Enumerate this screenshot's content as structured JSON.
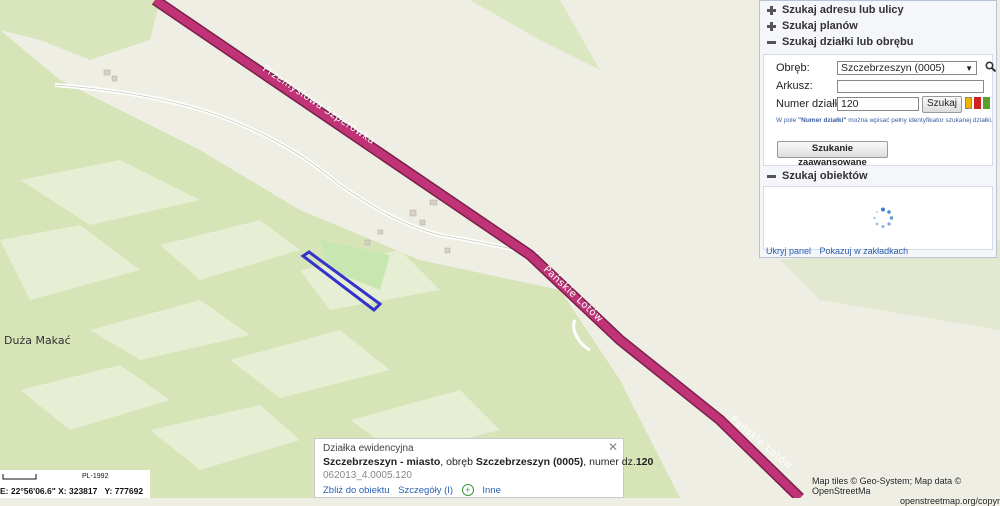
{
  "map": {
    "road_label_1": "Przemysłowa Szperówka",
    "road_label_2": "Pańskie Lotów",
    "road_label_3": "Pańskie Lotów",
    "place_label": "Duża Makać"
  },
  "panel": {
    "sections": [
      {
        "label": "Szukaj adresu lub ulicy",
        "state": "collapsed"
      },
      {
        "label": "Szukaj planów",
        "state": "collapsed"
      },
      {
        "label": "Szukaj działki lub obrębu",
        "state": "expanded"
      },
      {
        "label": "Szukaj obiektów",
        "state": "expanded"
      }
    ],
    "form": {
      "obreb_label": "Obręb:",
      "obreb_value": "Szczebrzeszyn (0005)",
      "arkusz_label": "Arkusz:",
      "arkusz_value": "",
      "numer_label": "Numer działki:",
      "numer_value": "120",
      "search_button": "Szukaj",
      "hint_prefix": "W pole ",
      "hint_field": "\"Numer działki\"",
      "hint_suffix": " można wpisać pełny identyfikator szukanej działki.",
      "advanced_button": "Szukanie zaawansowane"
    },
    "links": {
      "hide_panel": "Ukryj panel",
      "show_in_tabs": "Pokazuj w zakładkach"
    },
    "swatch_colors": [
      "#f0b400",
      "#d02020",
      "#5aa02a"
    ]
  },
  "popup": {
    "title": "Działka ewidencyjna",
    "town": "Szczebrzeszyn - miasto",
    "sep1": ", obręb ",
    "obreb": "Szczebrzeszyn (0005)",
    "sep2": ", numer dz.",
    "number": "120",
    "identifier": "062013_4.0005.120",
    "link_zoom": "Zbliż do obiektu",
    "link_details": "Szczegóły (I)",
    "link_other": "Inne"
  },
  "status": {
    "scale_label": "PL-1992",
    "coords_prefix": "E: 22°56'06.6\"",
    "x_label": "X: 323817",
    "y_label": "Y: 777692"
  },
  "attribution": {
    "line1": "Map tiles © Geo-System; Map data © OpenStreetMa",
    "line2": "openstreetmap.org/copyright"
  },
  "colors": {
    "road_main": "#b5306e",
    "parcel_outline": "#3333cc",
    "field_green": "#cfe0b2",
    "background": "#efeee4"
  }
}
